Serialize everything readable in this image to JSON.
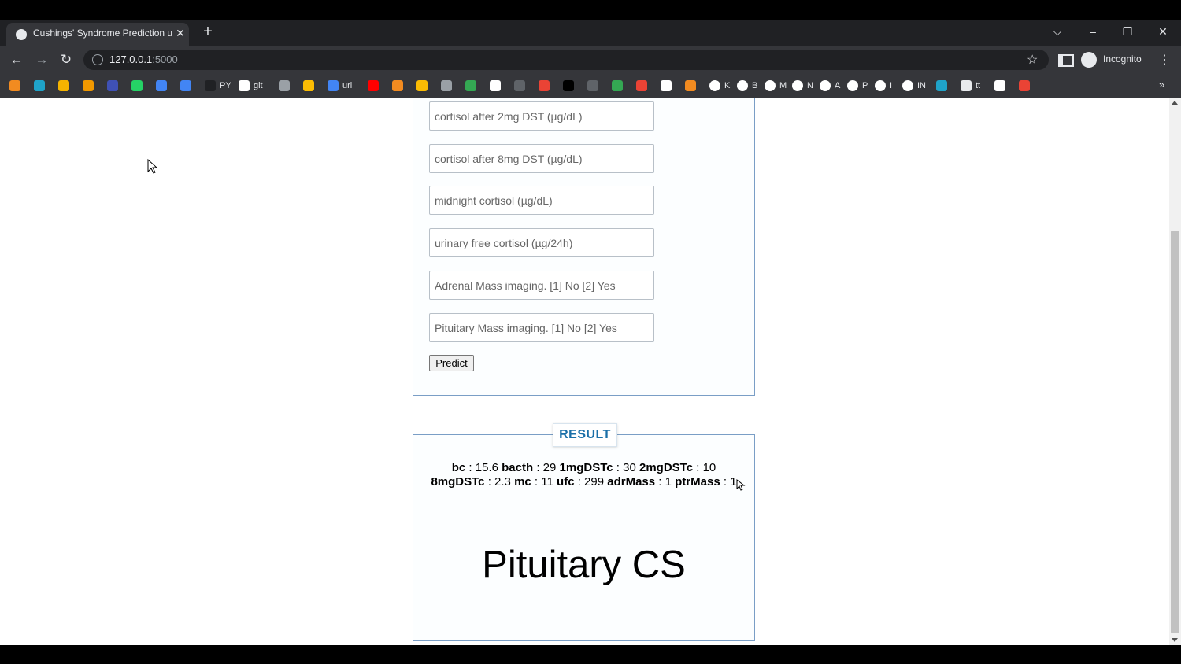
{
  "browser": {
    "tab_title": "Cushings' Syndrome Prediction u",
    "url_host": "127.0.0.1",
    "url_port": ":5000",
    "profile_label": "Incognito"
  },
  "bookmarks": [
    {
      "label": "",
      "color": "#f28b20"
    },
    {
      "label": "",
      "color": "#1fa3c9"
    },
    {
      "label": "",
      "color": "#f5b400"
    },
    {
      "label": "",
      "color": "#f29900"
    },
    {
      "label": "",
      "color": "#3f51b5"
    },
    {
      "label": "",
      "color": "#25d366"
    },
    {
      "label": "",
      "color": "#4285f4"
    },
    {
      "label": "",
      "color": "#4285f4"
    },
    {
      "label": "PY",
      "color": "#202124"
    },
    {
      "label": "git",
      "color": "#ffffff"
    },
    {
      "label": "",
      "color": "#9aa0a6"
    },
    {
      "label": "",
      "color": "#fbbc04"
    },
    {
      "label": "url",
      "color": "#4285f4"
    },
    {
      "label": "",
      "color": "#ff0000"
    },
    {
      "label": "",
      "color": "#f28b20"
    },
    {
      "label": "",
      "color": "#fbbc04"
    },
    {
      "label": "",
      "color": "#9aa0a6"
    },
    {
      "label": "",
      "color": "#34a853"
    },
    {
      "label": "",
      "color": "#ffffff"
    },
    {
      "label": "",
      "color": "#5f6368"
    },
    {
      "label": "",
      "color": "#ea4335"
    },
    {
      "label": "",
      "color": "#000000"
    },
    {
      "label": "",
      "color": "#5f6368"
    },
    {
      "label": "",
      "color": "#34a853"
    },
    {
      "label": "",
      "color": "#ea4335"
    },
    {
      "label": "",
      "color": "#ffffff"
    },
    {
      "label": "",
      "color": "#f28b20"
    },
    {
      "label": "K",
      "color": "#ffffff"
    },
    {
      "label": "B",
      "color": "#ffffff"
    },
    {
      "label": "M",
      "color": "#ffffff"
    },
    {
      "label": "N",
      "color": "#ffffff"
    },
    {
      "label": "A",
      "color": "#ffffff"
    },
    {
      "label": "P",
      "color": "#ffffff"
    },
    {
      "label": "I",
      "color": "#ffffff"
    },
    {
      "label": "IN",
      "color": "#ffffff"
    },
    {
      "label": "",
      "color": "#1fa3c9"
    },
    {
      "label": "tt",
      "color": "#e8eaed"
    },
    {
      "label": "",
      "color": "#ffffff"
    },
    {
      "label": "",
      "color": "#ea4335"
    }
  ],
  "form": {
    "fields": [
      {
        "name": "cortisol-2mg-dst-input",
        "placeholder": "cortisol after 2mg DST (µg/dL)"
      },
      {
        "name": "cortisol-8mg-dst-input",
        "placeholder": "cortisol after 8mg DST (µg/dL)"
      },
      {
        "name": "midnight-cortisol-input",
        "placeholder": "midnight cortisol (µg/dL)"
      },
      {
        "name": "urinary-free-cortisol-input",
        "placeholder": "urinary free cortisol (µg/24h)"
      },
      {
        "name": "adrenal-mass-input",
        "placeholder": "Adrenal Mass imaging. [1] No [2] Yes"
      },
      {
        "name": "pituitary-mass-input",
        "placeholder": "Pituitary Mass imaging. [1] No [2] Yes"
      }
    ],
    "predict_label": "Predict"
  },
  "result": {
    "heading": "RESULT",
    "values": [
      {
        "key": "bc",
        "value": "15.6"
      },
      {
        "key": "bacth",
        "value": "29"
      },
      {
        "key": "1mgDSTc",
        "value": "30"
      },
      {
        "key": "2mgDSTc",
        "value": "10"
      },
      {
        "key": "8mgDSTc",
        "value": "2.3"
      },
      {
        "key": "mc",
        "value": "11"
      },
      {
        "key": "ufc",
        "value": "299"
      },
      {
        "key": "adrMass",
        "value": "1"
      },
      {
        "key": "ptrMass",
        "value": "1"
      }
    ],
    "prediction": "Pituitary CS"
  }
}
